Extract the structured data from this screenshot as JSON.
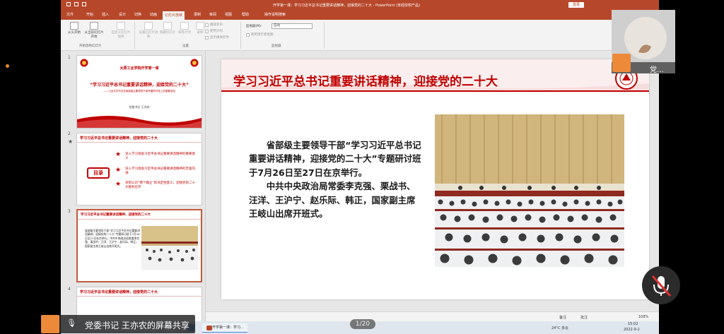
{
  "window": {
    "title": "开学第一课：学习习近平总书记重要讲话精神，迎接党的二十大 - PowerPoint (未经授权产品)",
    "signin": "登录"
  },
  "ribbon": {
    "tabs": [
      "文件",
      "开始",
      "插入",
      "设计",
      "切换",
      "动画",
      "幻灯片放映",
      "录制",
      "审阅",
      "视图",
      "帮助",
      "操作说明搜索"
    ],
    "active_tab": "幻灯片放映",
    "buttons": {
      "from_start": "从头开始",
      "from_current": "从当前幻灯片开始",
      "custom": "自定义幻灯片放映",
      "setup": "设置幻灯片放映",
      "hide": "隐藏幻灯片",
      "rehearse": "排练计时",
      "record": "录制"
    },
    "checkboxes": {
      "play_narration": "播放旁白",
      "use_timing": "使用计时",
      "show_media": "显示媒体控件",
      "presenter_view": "使用演示者视图"
    },
    "monitor_label": "监视器(M):",
    "monitor_value": "自动",
    "groups": {
      "start": "开始放映幻灯片",
      "setup": "设置",
      "monitor": "监视器"
    }
  },
  "thumbnails": [
    {
      "number": "1",
      "school": "太原工业学院开学第一课",
      "title": "“学习习近平总书记重要讲话精神，迎接党的二十大”",
      "subtitle": "——习近平总书记在省部级主要领导干部专题研讨班上的重要讲话",
      "author": "党委书记 王亦农"
    },
    {
      "number": "2",
      "header": "学习习近平总书记重要讲话精神，迎接党的二十大",
      "menu_label": "目录",
      "items": [
        "深入学习领会习近平总书记重要讲话精神的重要意义",
        "深入学习领会习近平总书记重要讲话精神的丰富内涵",
        "深刻认识“两个确立”的决定性意义，迎接党的二十大胜利召开"
      ]
    },
    {
      "number": "3",
      "text": "省部级主要领导干部“学习习近平总书记重要讲话精神，迎接党的二十大”专题研讨班于7月26日至27日在京举行。中共中央政治局常委李克强、栗战书、汪洋、王沪宁、赵乐际、韩正，国家副主席王岐山出席开班式。"
    },
    {
      "number": "4",
      "header": "学习习近平总书记重要讲话精神，迎接党的二十大"
    }
  ],
  "slide": {
    "title": "学习习近平总书记重要讲话精神，迎接党的二十大",
    "para1": "省部级主要领导干部“学习习近平总书记重要讲话精神，迎接党的二十大”专题研讨班于7月26日至27日在京举行。",
    "para2": "中共中央政治局常委李克强、栗战书、汪洋、王沪宁、赵乐际、韩正，国家副主席王岐山出席开班式。"
  },
  "statusbar": {
    "notes": "备注",
    "comments": "批注",
    "zoom": "108%"
  },
  "taskbar": {
    "app1": "开学第一课：学习...",
    "weather": "24°C 多云",
    "time": "15:02",
    "date": "2022-9-2"
  },
  "overlay": {
    "camera_label": "党...",
    "share_label": "党委书记 王亦农的屏幕共享",
    "page_indicator": "1/20"
  },
  "colors": {
    "accent": "#b7472a",
    "slide_red": "#c00000",
    "avatar_orange": "#ec8a3a"
  }
}
